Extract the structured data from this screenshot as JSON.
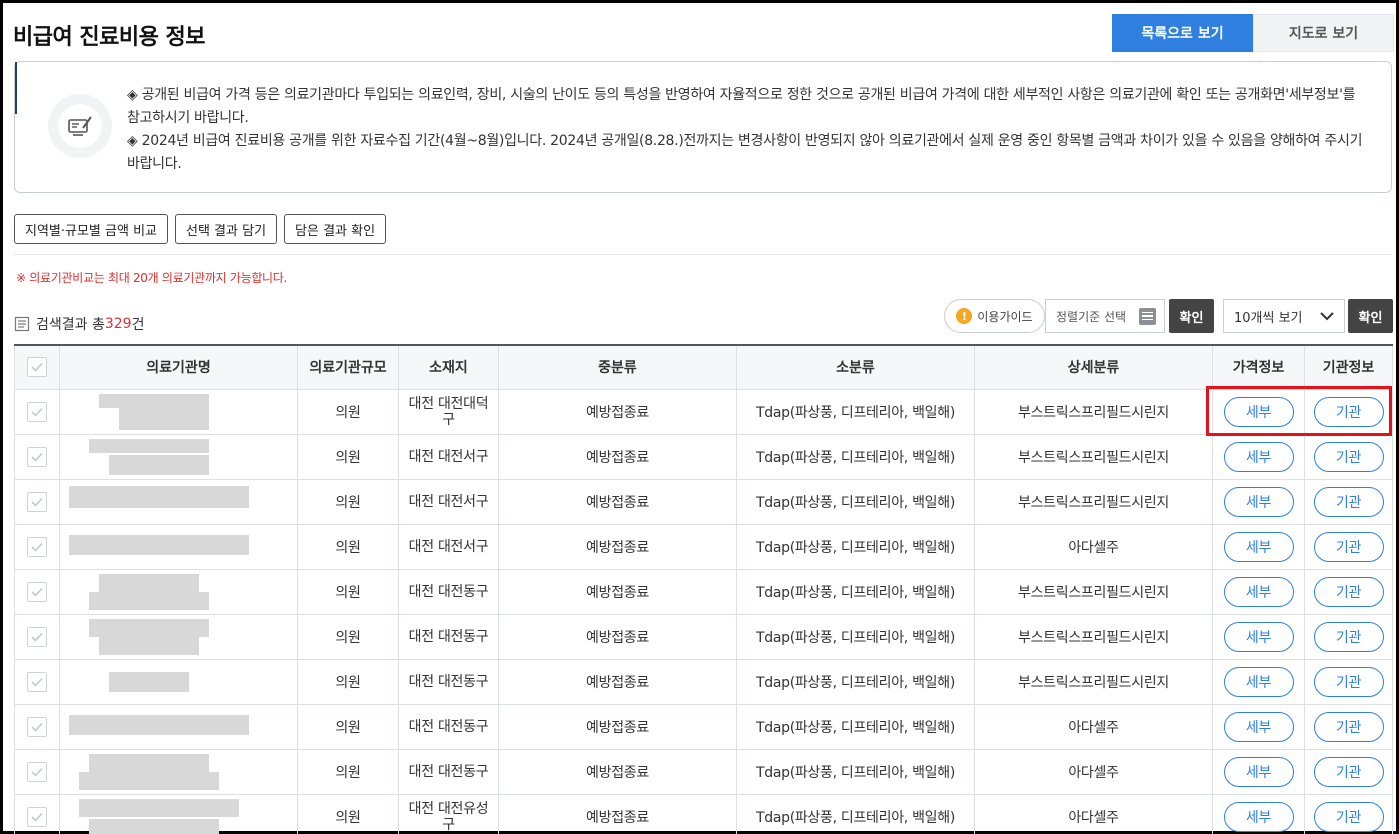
{
  "page": {
    "title": "비급여 진료비용 정보",
    "view_list_label": "목록으로 보기",
    "view_map_label": "지도로 보기"
  },
  "notice": {
    "line1": "◈ 공개된 비급여 가격 등은 의료기관마다 투입되는 의료인력, 장비, 시술의 난이도 등의 특성을 반영하여 자율적으로 정한 것으로 공개된 비급여 가격에 대한 세부적인 사항은 의료기관에 확인 또는 공개화면'세부정보'를 참고하시기 바랍니다.",
    "line2": "◈ 2024년 비급여 진료비용 공개를 위한 자료수집 기간(4월~8월)입니다. 2024년 공개일(8.28.)전까지는 변경사항이 반영되지 않아 의료기관에서 실제 운영 중인 항목별 금액과 차이가 있을 수 있음을 양해하여 주시기 바랍니다."
  },
  "actions": {
    "compare_label": "지역별·규모별 금액 비교",
    "add_label": "선택 결과 담기",
    "check_label": "담은 결과 확인"
  },
  "warning": "※ 의료기관비교는 최대 20개 의료기관까지 가능합니다.",
  "results": {
    "prefix": "검색결과 총",
    "count": "329",
    "suffix": "건"
  },
  "controls": {
    "guide_label": "이용가이드",
    "sort_placeholder": "정렬기준 선택",
    "confirm_label": "확인",
    "page_size_label": "10개씩 보기",
    "confirm2_label": "확인"
  },
  "table": {
    "headers": [
      "의료기관명",
      "의료기관규모",
      "소재지",
      "중분류",
      "소분류",
      "상세분류",
      "가격정보",
      "기관정보"
    ],
    "rows": [
      {
        "size": "의원",
        "loc": "대전 대전대덕구",
        "mid": "예방접종료",
        "sub": "Tdap(파상풍, 디프테리아, 백일해)",
        "detail": "부스트릭스프리필드시린지",
        "price_btn": "세부",
        "inst_btn": "기관"
      },
      {
        "size": "의원",
        "loc": "대전 대전서구",
        "mid": "예방접종료",
        "sub": "Tdap(파상풍, 디프테리아, 백일해)",
        "detail": "부스트릭스프리필드시린지",
        "price_btn": "세부",
        "inst_btn": "기관"
      },
      {
        "size": "의원",
        "loc": "대전 대전서구",
        "mid": "예방접종료",
        "sub": "Tdap(파상풍, 디프테리아, 백일해)",
        "detail": "부스트릭스프리필드시린지",
        "price_btn": "세부",
        "inst_btn": "기관"
      },
      {
        "size": "의원",
        "loc": "대전 대전서구",
        "mid": "예방접종료",
        "sub": "Tdap(파상풍, 디프테리아, 백일해)",
        "detail": "아다셀주",
        "price_btn": "세부",
        "inst_btn": "기관"
      },
      {
        "size": "의원",
        "loc": "대전 대전동구",
        "mid": "예방접종료",
        "sub": "Tdap(파상풍, 디프테리아, 백일해)",
        "detail": "부스트릭스프리필드시린지",
        "price_btn": "세부",
        "inst_btn": "기관"
      },
      {
        "size": "의원",
        "loc": "대전 대전동구",
        "mid": "예방접종료",
        "sub": "Tdap(파상풍, 디프테리아, 백일해)",
        "detail": "부스트릭스프리필드시린지",
        "price_btn": "세부",
        "inst_btn": "기관"
      },
      {
        "size": "의원",
        "loc": "대전 대전동구",
        "mid": "예방접종료",
        "sub": "Tdap(파상풍, 디프테리아, 백일해)",
        "detail": "부스트릭스프리필드시린지",
        "price_btn": "세부",
        "inst_btn": "기관"
      },
      {
        "size": "의원",
        "loc": "대전 대전동구",
        "mid": "예방접종료",
        "sub": "Tdap(파상풍, 디프테리아, 백일해)",
        "detail": "아다셀주",
        "price_btn": "세부",
        "inst_btn": "기관"
      },
      {
        "size": "의원",
        "loc": "대전 대전동구",
        "mid": "예방접종료",
        "sub": "Tdap(파상풍, 디프테리아, 백일해)",
        "detail": "아다셀주",
        "price_btn": "세부",
        "inst_btn": "기관"
      },
      {
        "size": "의원",
        "loc": "대전 대전유성구",
        "mid": "예방접종료",
        "sub": "Tdap(파상풍, 디프테리아, 백일해)",
        "detail": "아다셀주",
        "price_btn": "세부",
        "inst_btn": "기관"
      }
    ]
  },
  "colors": {
    "accent": "#2f7fe0",
    "warning_red": "#d9322f",
    "highlight": "#e8101a",
    "dark_button": "#444444"
  },
  "icons": {
    "notice": "monitor-pen-icon",
    "result": "list-doc-icon",
    "guide": "info-icon",
    "sort": "list-icon",
    "dropdown": "chevron-down-icon",
    "checkbox": "check-icon"
  }
}
